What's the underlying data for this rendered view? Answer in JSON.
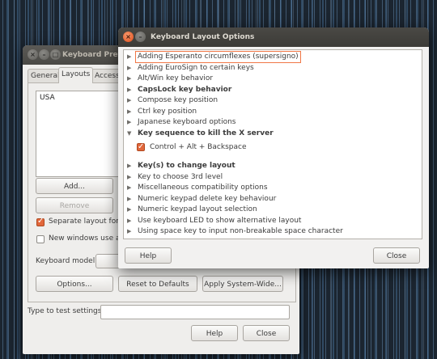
{
  "back_window": {
    "title": "Keyboard Prefe",
    "tabs": [
      "General",
      "Layouts",
      "Accessi"
    ],
    "layouts_list": [
      "USA"
    ],
    "add_label": "Add...",
    "remove_label": "Remove",
    "separate_layout_label": "Separate layout for ea",
    "separate_layout_checked": true,
    "new_windows_label": "New windows use acti",
    "new_windows_checked": false,
    "keyboard_model_label": "Keyboard model:",
    "options_label": "Options...",
    "reset_label": "Reset to Defaults",
    "apply_label": "Apply System-Wide...",
    "test_label": "Type to test settings:",
    "test_value": "",
    "help_label": "Help",
    "close_label": "Close"
  },
  "dialog": {
    "title": "Keyboard Layout Options",
    "items": [
      {
        "label": "Adding Esperanto circumflexes (supersigno)",
        "expanded": false,
        "bold": false,
        "selected": true
      },
      {
        "label": "Adding EuroSign to certain keys",
        "expanded": false,
        "bold": false
      },
      {
        "label": "Alt/Win key behavior",
        "expanded": false,
        "bold": false
      },
      {
        "label": "CapsLock key behavior",
        "expanded": false,
        "bold": true
      },
      {
        "label": "Compose key position",
        "expanded": false,
        "bold": false
      },
      {
        "label": "Ctrl key position",
        "expanded": false,
        "bold": false
      },
      {
        "label": "Japanese keyboard options",
        "expanded": false,
        "bold": false
      },
      {
        "label": "Key sequence to kill the X server",
        "expanded": true,
        "bold": true
      },
      {
        "label": "Key(s) to change layout",
        "expanded": false,
        "bold": true
      },
      {
        "label": "Key to choose 3rd level",
        "expanded": false,
        "bold": false
      },
      {
        "label": "Miscellaneous compatibility options",
        "expanded": false,
        "bold": false
      },
      {
        "label": "Numeric keypad delete key behaviour",
        "expanded": false,
        "bold": false
      },
      {
        "label": "Numeric keypad layout selection",
        "expanded": false,
        "bold": false
      },
      {
        "label": "Use keyboard LED to show alternative layout",
        "expanded": false,
        "bold": false
      },
      {
        "label": "Using space key to input non-breakable space character",
        "expanded": false,
        "bold": false
      }
    ],
    "suboption": {
      "label": "Control + Alt + Backspace",
      "checked": true
    },
    "help_label": "Help",
    "close_label": "Close"
  },
  "icons": {
    "close": "close-icon",
    "minimize": "minimize-icon",
    "maximize": "maximize-icon",
    "expander_collapsed": "triangle-right-icon",
    "expander_expanded": "triangle-down-icon"
  },
  "colors": {
    "accent": "#e2673b",
    "titlebar": "#3c3b37",
    "window_bg": "#f2f1f0",
    "highlight_border": "#f07746"
  }
}
